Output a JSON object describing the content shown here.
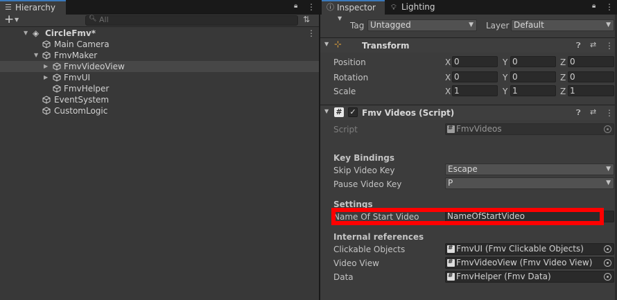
{
  "hierarchy": {
    "tab_label": "Hierarchy",
    "search_placeholder": "All",
    "items": [
      {
        "label": "CircleFmv*"
      },
      {
        "label": "Main Camera"
      },
      {
        "label": "FmvMaker"
      },
      {
        "label": "FmvVideoView"
      },
      {
        "label": "FmvUI"
      },
      {
        "label": "FmvHelper"
      },
      {
        "label": "EventSystem"
      },
      {
        "label": "CustomLogic"
      }
    ]
  },
  "inspector": {
    "tab_label": "Inspector",
    "lighting_tab_label": "Lighting",
    "tag_label": "Tag",
    "tag_value": "Untagged",
    "layer_label": "Layer",
    "layer_value": "Default",
    "transform": {
      "title": "Transform",
      "position_label": "Position",
      "rotation_label": "Rotation",
      "scale_label": "Scale",
      "x": "X",
      "y": "Y",
      "z": "Z",
      "position": [
        "0",
        "0",
        "0"
      ],
      "rotation": [
        "0",
        "0",
        "0"
      ],
      "scale": [
        "1",
        "1",
        "1"
      ]
    },
    "fmv_videos": {
      "title": "Fmv Videos (Script)",
      "script_label": "Script",
      "script_value": "FmvVideos",
      "key_bindings_header": "Key Bindings",
      "skip_label": "Skip Video Key",
      "skip_value": "Escape",
      "pause_label": "Pause Video Key",
      "pause_value": "P",
      "settings_header": "Settings",
      "start_video_label": "Name Of Start Video",
      "start_video_value": "NameOfStartVideo",
      "internal_header": "Internal references",
      "clickable_label": "Clickable Objects",
      "clickable_value": "FmvUI (Fmv Clickable Objects)",
      "video_view_label": "Video View",
      "video_view_value": "FmvVideoView (Fmv Video View)",
      "data_label": "Data",
      "data_value": "FmvHelper (Fmv Data)"
    }
  },
  "colors": {
    "highlight_box": "#ff0000",
    "tab_accent": "#3a79bb",
    "selected_row": "#474747"
  }
}
